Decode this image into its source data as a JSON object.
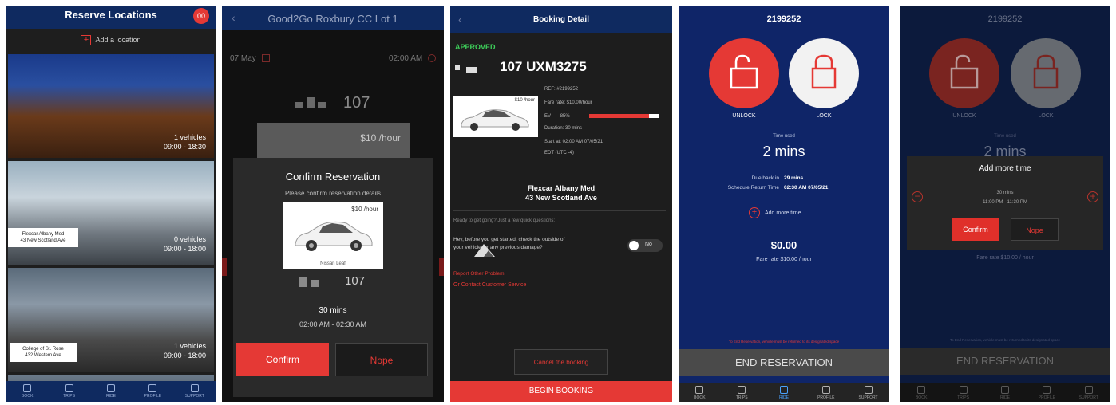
{
  "screen1": {
    "title": "Reserve Locations",
    "badge": "00",
    "add_location": "Add a location",
    "locations": [
      {
        "vehicles": "1 vehicles",
        "hours": "09:00 - 18:30"
      },
      {
        "vehicles": "0 vehicles",
        "hours": "09:00 - 18:00",
        "label_line1": "Flexcar Albany Med",
        "label_line2": "43 New Scotland Ave"
      },
      {
        "vehicles": "1 vehicles",
        "hours": "09:00 - 18:00",
        "label_line1": "College of St. Rose",
        "label_line2": "432 Western Ave"
      }
    ],
    "tabs": [
      "BOOK",
      "TRIPS",
      "RIDE",
      "PROFILE",
      "SUPPORT"
    ]
  },
  "screen2": {
    "title": "Good2Go Roxbury CC Lot 1",
    "date": "07 May",
    "time": "02:00 AM",
    "car_number": "107",
    "rate": "$10 /hour",
    "modal_title": "Confirm Reservation",
    "modal_subtitle": "Please confirm reservation details",
    "modal_rate": "$10 /hour",
    "modal_car_caption": "Nissan Leaf",
    "modal_car_number": "107",
    "duration": "30 mins",
    "time_range": "02:00 AM - 02:30 AM",
    "confirm_label": "Confirm",
    "nope_label": "Nope"
  },
  "screen3": {
    "title": "Booking Detail",
    "status": "APPROVED",
    "vehicle": "107 UXM3275",
    "ref": "REF: #2199252",
    "fare_rate": "Fare rate: $10.00/hour",
    "battery_label": "EV",
    "battery_pct": "85%",
    "battery_fill": 0.85,
    "duration": "Duration: 30 mins",
    "start_at": "Start at: 02:00 AM 07/05/21",
    "timezone": "EDT (UTC -4)",
    "car_rate": "$10 /hour",
    "location_name": "Flexcar Albany Med",
    "location_address": "43 New Scotland Ave",
    "ready_text": "Ready to get going? Just a few quick questions:",
    "check_text_1": "Hey, before you get started, check the outside of",
    "check_text_2": "your vehicle for any previous damage?",
    "toggle_label": "No",
    "report_link": "Report Other Problem",
    "contact_link": "Or Contact Customer Service",
    "cancel_label": "Cancel the booking",
    "begin_label": "BEGIN BOOKING"
  },
  "screen4": {
    "ref_number": "2199252",
    "unlock_label": "UNLOCK",
    "lock_label": "LOCK",
    "time_used_label": "Time used",
    "time_used": "2 mins",
    "due_back_label": "Due back in",
    "due_back": "29 mins",
    "schedule_label": "Schedule Return Time",
    "schedule_time": "02:30 AM 07/05/21",
    "add_more_time": "Add more time",
    "amount": "$0.00",
    "fare_rate": "Fare rate $10.00 /hour",
    "footer_note": "To End Reservation, vehicle must be returned to its designated space",
    "end_label": "END RESERVATION",
    "tabs": [
      "BOOK",
      "TRIPS",
      "RIDE",
      "PROFILE",
      "SUPPORT"
    ]
  },
  "screen5": {
    "ref_number": "2199252",
    "unlock_label": "UNLOCK",
    "lock_label": "LOCK",
    "time_used_label": "Time used",
    "time_used": "2 mins",
    "modal_title": "Add more time",
    "modal_duration": "30 mins",
    "modal_range": "11:00 PM - 11:30 PM",
    "confirm_label": "Confirm",
    "nope_label": "Nope",
    "fare_rate": "Fare rate $10.00 / hour",
    "footer_note": "To End Reservation, vehicle must be returned to its designated space",
    "end_label": "END RESERVATION",
    "tabs": [
      "BOOK",
      "TRIPS",
      "RIDE",
      "PROFILE",
      "SUPPORT"
    ]
  },
  "colors": {
    "accent": "#e53935",
    "navy": "#0f2a60",
    "approved": "#3ecf5a"
  }
}
